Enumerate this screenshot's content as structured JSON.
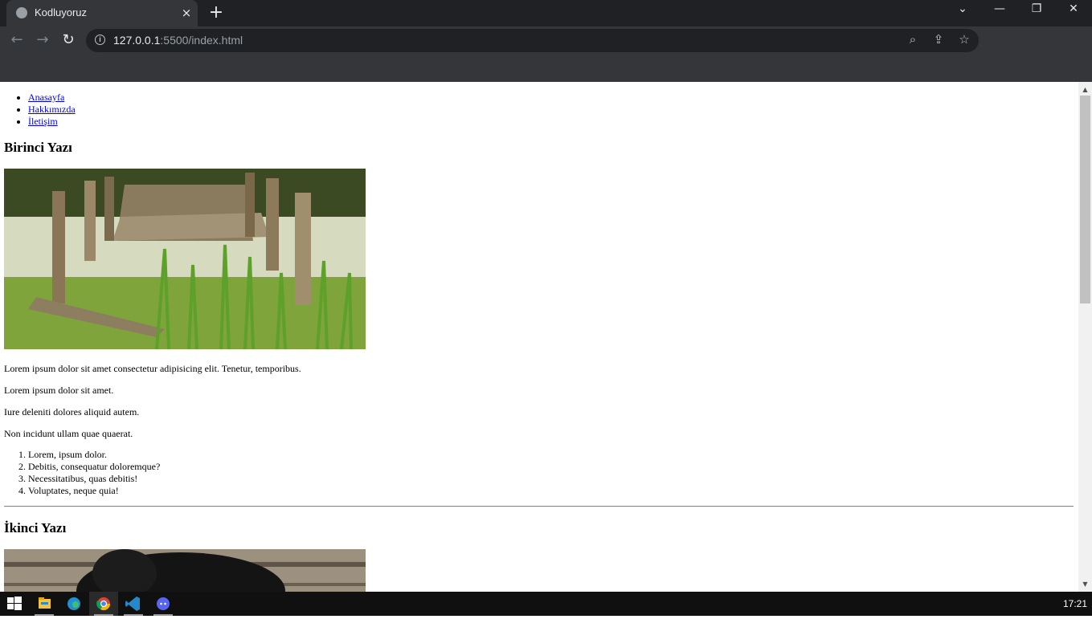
{
  "browser": {
    "tab": {
      "title": "Kodluyoruz",
      "close_glyph": "×"
    },
    "new_tab_glyph": "+",
    "window_controls": {
      "dropdown": "⌄",
      "minimize": "—",
      "restore": "❐",
      "close": "✕"
    },
    "nav": {
      "back": "←",
      "forward": "→",
      "reload": "↻"
    },
    "address": {
      "host": "127.0.0.1",
      "rest": ":5500/index.html"
    },
    "omnibox_icons": {
      "zoom": "⌕",
      "share": "⇪",
      "bookmark": "☆"
    }
  },
  "page": {
    "nav_links": [
      "Anasayfa",
      "Hakkımızda",
      "İletişim"
    ],
    "post1": {
      "title": "Birinci Yazı",
      "paragraphs": [
        "Lorem ipsum dolor sit amet consectetur adipisicing elit. Tenetur, temporibus.",
        "Lorem ipsum dolor sit amet.",
        "Iure deleniti dolores aliquid autem.",
        "Non incidunt ullam quae quaerat."
      ],
      "list": [
        "Lorem, ipsum dolor.",
        "Debitis, consequatur doloremque?",
        "Necessitatibus, quas debitis!",
        "Voluptates, neque quia!"
      ]
    },
    "post2": {
      "title": "İkinci Yazı"
    }
  },
  "taskbar": {
    "apps": [
      "start-icon",
      "file-explorer-icon",
      "edge-icon",
      "chrome-icon",
      "vscode-icon",
      "discord-icon"
    ],
    "clock": "17:21"
  },
  "colors": {
    "link": "#0000ee",
    "chrome_dark": "#202124",
    "toolbar": "#35363a"
  }
}
